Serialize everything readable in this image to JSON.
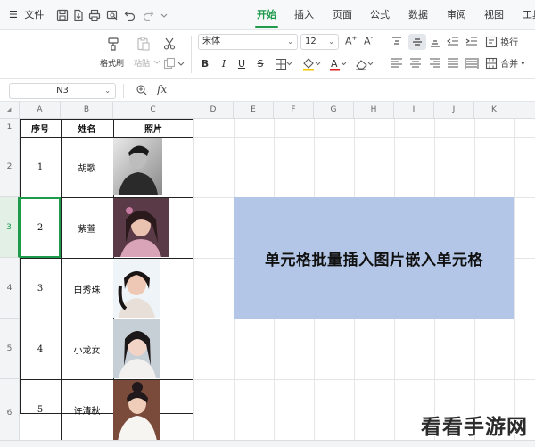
{
  "menubar": {
    "menu_icon": "hamburger-icon",
    "file_label": "文件",
    "tabs": [
      {
        "label": "开始",
        "active": true
      },
      {
        "label": "插入",
        "active": false
      },
      {
        "label": "页面",
        "active": false
      },
      {
        "label": "公式",
        "active": false
      },
      {
        "label": "数据",
        "active": false
      },
      {
        "label": "审阅",
        "active": false
      },
      {
        "label": "视图",
        "active": false
      },
      {
        "label": "工具",
        "active": false
      }
    ]
  },
  "ribbon": {
    "format_painter_label": "格式刷",
    "paste_label": "粘贴",
    "font_name": "宋体",
    "font_size": "12",
    "wrap_label": "换行",
    "merge_label": "合并"
  },
  "formula_bar": {
    "cell_ref": "N3",
    "fx_label": "fx",
    "formula": ""
  },
  "sheet": {
    "columns": [
      "A",
      "B",
      "C",
      "D",
      "E",
      "F",
      "G",
      "H",
      "I",
      "J",
      "K"
    ],
    "rows": [
      "1",
      "2",
      "3",
      "4",
      "5",
      "6"
    ],
    "selected_row": "3",
    "table_headers": [
      "序号",
      "姓名",
      "照片"
    ],
    "table_rows": [
      {
        "index": "1",
        "name": "胡歌"
      },
      {
        "index": "2",
        "name": "紫萱"
      },
      {
        "index": "3",
        "name": "白秀珠"
      },
      {
        "index": "4",
        "name": "小龙女"
      },
      {
        "index": "5",
        "name": "许清秋"
      }
    ],
    "banner_text": "单元格批量插入图片嵌入单元格"
  },
  "watermark": "看看手游网",
  "colors": {
    "accent": "#1d9a4a",
    "banner_bg": "#b4c6e7",
    "header_bg": "#f3f4f6"
  }
}
